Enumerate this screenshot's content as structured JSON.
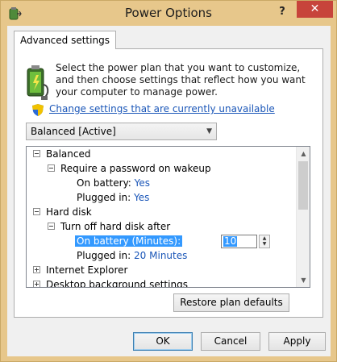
{
  "window": {
    "title": "Power Options",
    "help_glyph": "?",
    "close_glyph": "✕"
  },
  "tab": {
    "label": "Advanced settings"
  },
  "description": "Select the power plan that you want to customize, and then choose settings that reflect how you want your computer to manage power.",
  "change_link": "Change settings that are currently unavailable",
  "plan_select": {
    "value": "Balanced [Active]"
  },
  "tree": {
    "balanced": "Balanced",
    "require_password": "Require a password on wakeup",
    "on_battery_label": "On battery:",
    "on_battery_value": "Yes",
    "plugged_in_label": "Plugged in:",
    "plugged_in_value": "Yes",
    "hard_disk": "Hard disk",
    "turn_off_hd": "Turn off hard disk after",
    "hd_on_battery_label": "On battery (Minutes):",
    "hd_on_battery_value": "10",
    "hd_plugged_in_label": "Plugged in:",
    "hd_plugged_in_value": "20 Minutes",
    "internet_explorer": "Internet Explorer",
    "desktop_background": "Desktop background settings"
  },
  "buttons": {
    "restore": "Restore plan defaults",
    "ok": "OK",
    "cancel": "Cancel",
    "apply": "Apply"
  },
  "colors": {
    "frame": "#e7c78b",
    "close": "#c7443b",
    "link": "#1a56b8",
    "selection": "#3399ff"
  }
}
